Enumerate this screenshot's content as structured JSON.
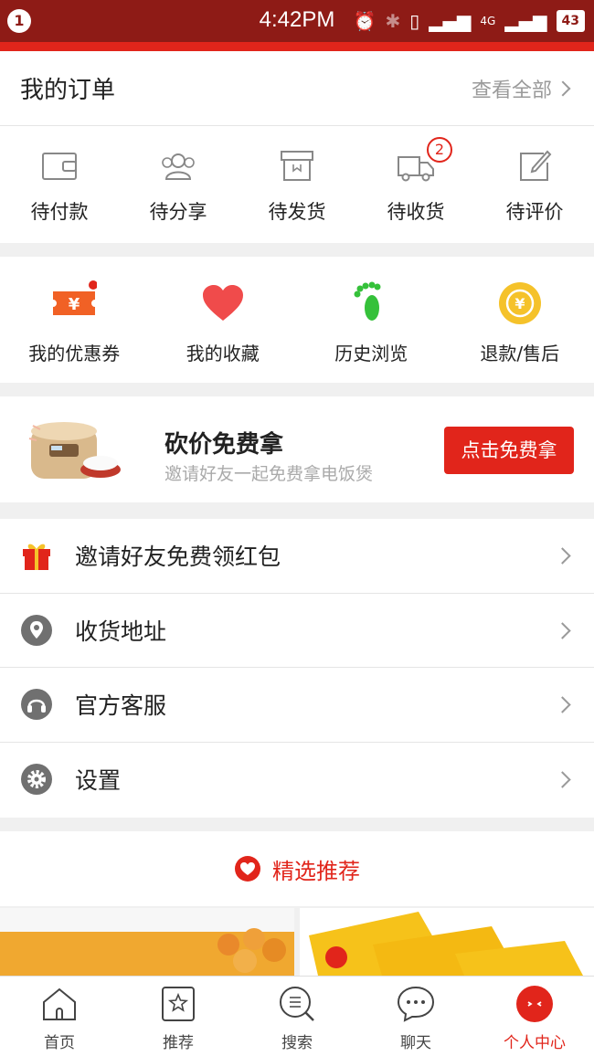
{
  "status_bar": {
    "notification_count": "1",
    "time": "4:42PM",
    "network": "4G",
    "battery": "43"
  },
  "orders": {
    "title": "我的订单",
    "view_all": "查看全部",
    "items": [
      {
        "label": "待付款",
        "icon": "wallet-icon"
      },
      {
        "label": "待分享",
        "icon": "users-icon"
      },
      {
        "label": "待发货",
        "icon": "package-icon"
      },
      {
        "label": "待收货",
        "icon": "truck-icon",
        "badge": "2"
      },
      {
        "label": "待评价",
        "icon": "edit-icon"
      }
    ]
  },
  "quick_links": [
    {
      "label": "我的优惠券",
      "icon": "coupon-icon"
    },
    {
      "label": "我的收藏",
      "icon": "heart-icon"
    },
    {
      "label": "历史浏览",
      "icon": "footprint-icon"
    },
    {
      "label": "退款/售后",
      "icon": "refund-icon"
    }
  ],
  "promo": {
    "title": "砍价免费拿",
    "subtitle": "邀请好友一起免费拿电饭煲",
    "button": "点击免费拿"
  },
  "menu": [
    {
      "label": "邀请好友免费领红包",
      "icon": "gift-icon"
    },
    {
      "label": "收货地址",
      "icon": "location-icon"
    },
    {
      "label": "官方客服",
      "icon": "headset-icon"
    },
    {
      "label": "设置",
      "icon": "gear-icon"
    }
  ],
  "recommend": {
    "title": "精选推荐"
  },
  "tabs": [
    {
      "label": "首页",
      "icon": "home-icon"
    },
    {
      "label": "推荐",
      "icon": "star-icon"
    },
    {
      "label": "搜索",
      "icon": "search-icon"
    },
    {
      "label": "聊天",
      "icon": "chat-icon"
    },
    {
      "label": "个人中心",
      "icon": "profile-icon",
      "active": true
    }
  ],
  "colors": {
    "brand_red": "#e1251b",
    "status_bar": "#8e1b16",
    "background": "#f0f0f0"
  }
}
